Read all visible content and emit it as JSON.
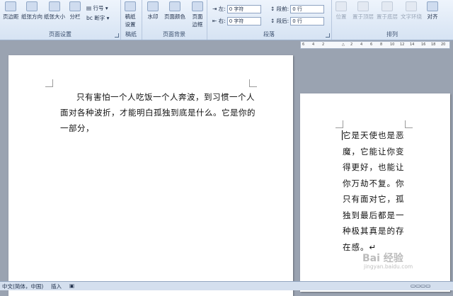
{
  "ribbon": {
    "page_setup": {
      "group_label": "页面设置",
      "margins": "页边距",
      "orientation": "纸张方向",
      "size": "纸张大小",
      "columns": "分栏",
      "line_numbers": "行号",
      "hyphenation": "断字"
    },
    "manuscript": {
      "group_label": "稿纸",
      "setup": "稿纸设置"
    },
    "page_background": {
      "group_label": "页面背景",
      "watermark": "水印",
      "page_color": "页面颜色",
      "page_border": "页面边框"
    },
    "paragraph": {
      "group_label": "段落",
      "indent_left_label": "左:",
      "indent_left_value": "0 字符",
      "indent_right_label": "右:",
      "indent_right_value": "0 字符",
      "space_before_label": "段前:",
      "space_before_value": "0 行",
      "space_after_label": "段后:",
      "space_after_value": "0 行"
    },
    "arrange": {
      "group_label": "排列",
      "position": "位置",
      "bring_front": "置于顶层",
      "send_back": "置于底层",
      "wrap": "文字环绕",
      "align": "对齐"
    }
  },
  "ruler": {
    "ticks": [
      "6",
      "4",
      "2",
      "2",
      "4",
      "6",
      "8",
      "10",
      "12",
      "14",
      "16",
      "18",
      "20"
    ]
  },
  "document": {
    "page1_text": "只有害怕一个人吃饭一个人奔波，到习惯一个人面对各种波折，才能明白孤独到底是什么。它是你的一部分，",
    "page2_text": "它是天使也是恶魔，它能让你变得更好，也能让你万劫不复。你只有面对它，孤独到最后都是一种极其真是的存在感。↵"
  },
  "status": {
    "language": "中文(简体，中国)",
    "mode": "插入"
  },
  "watermark": {
    "brand": "Bai 经验",
    "url": "jingyan.baidu.com"
  }
}
